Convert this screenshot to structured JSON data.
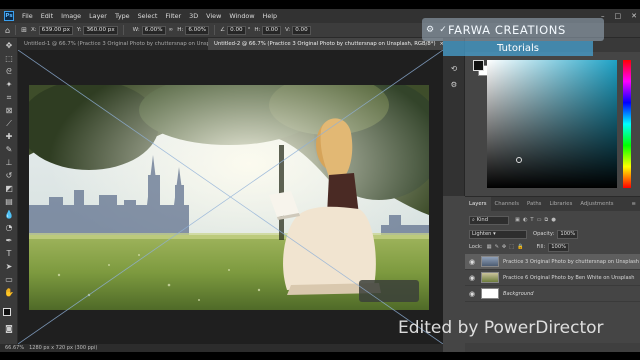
{
  "menubar": {
    "logo": "Ps",
    "items": [
      "File",
      "Edit",
      "Image",
      "Layer",
      "Type",
      "Select",
      "Filter",
      "3D",
      "View",
      "Window",
      "Help"
    ],
    "window_controls": [
      "–",
      "□",
      "✕"
    ]
  },
  "options_bar": {
    "x_label": "X:",
    "x_value": "639.00 px",
    "y_label": "Y:",
    "y_value": "360.00 px",
    "w_value": "6.00%",
    "h_value": "6.00%",
    "angle_value": "0.00",
    "interpolation": "Bicubic",
    "mode_label": "Warp",
    "cancel_icon": "cancel-icon",
    "commit_icon": "check-icon"
  },
  "tabs": [
    {
      "label": "Untitled-1 @ 66.7% (Practice 3 Original Photo by chuttersnap on Unsplash, RGB/8) ×",
      "active": false
    },
    {
      "label": "Untitled-2 @ 66.7% (Practice 3 Original Photo by chuttersnap on Unsplash, RGB/8*)",
      "close": "×",
      "active": true
    }
  ],
  "status": {
    "zoom": "66.67%",
    "doc_info": "1280 px x 720 px (300 ppi)"
  },
  "overlays": {
    "brand": "FARWA CREATIONS",
    "tutorials": "Tutorials",
    "watermark": "Edited by PowerDirector"
  },
  "layers_panel": {
    "tabs": [
      "Layers",
      "Channels",
      "Paths",
      "Libraries",
      "Adjustments"
    ],
    "menu_icon": "≡",
    "kind_label": "Kind",
    "blend_mode": "Lighten",
    "opacity_label": "Opacity:",
    "opacity_value": "100%",
    "lock_label": "Lock:",
    "fill_label": "Fill:",
    "fill_value": "100%",
    "layers": [
      {
        "name": "Practice 3 Original Photo by chuttersnap on Unsplash",
        "visible": true,
        "selected": true
      },
      {
        "name": "Practice 6 Original Photo by Ben White on Unsplash",
        "visible": true,
        "selected": false
      },
      {
        "name": "Background",
        "visible": true,
        "selected": false
      }
    ]
  },
  "colors": {
    "accent": "#1ea2c6",
    "overlay_blue": "#46a5d7"
  }
}
